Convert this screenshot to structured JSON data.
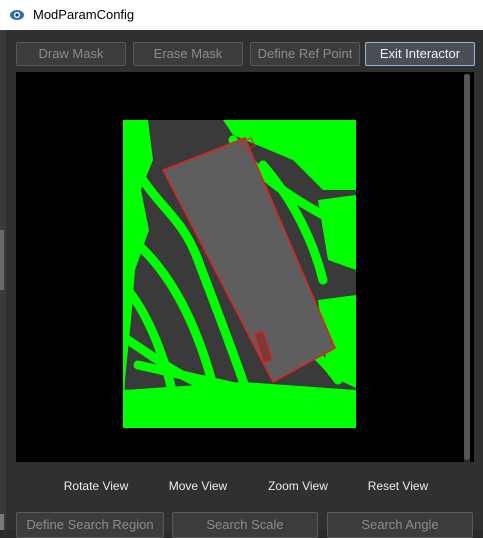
{
  "window": {
    "title": "ModParamConfig",
    "icon": "eye-icon"
  },
  "toolbar": {
    "draw_mask": "Draw Mask",
    "erase_mask": "Erase Mask",
    "define_ref_point": "Define Ref Point",
    "exit_interactor": "Exit Interactor"
  },
  "view_controls": {
    "rotate": "Rotate View",
    "move": "Move View",
    "zoom": "Zoom View",
    "reset": "Reset View"
  },
  "bottom_buttons": {
    "define_search_region": "Define Search Region",
    "search_scale": "Search Scale",
    "search_angle": "Search Angle"
  },
  "colors": {
    "mask": "#00ff00",
    "outline": "#e02020",
    "accent_border": "#8fb4d6"
  }
}
